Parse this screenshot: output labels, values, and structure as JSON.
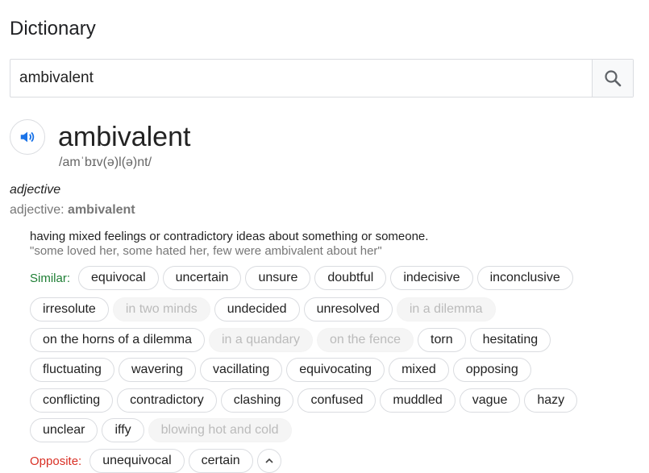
{
  "header": {
    "title": "Dictionary"
  },
  "search": {
    "value": "ambivalent",
    "button_icon": "search-icon"
  },
  "entry": {
    "audio_icon": "speaker-icon",
    "word": "ambivalent",
    "phonetic": "/amˈbɪv(ə)l(ə)nt/",
    "part_of_speech": "adjective",
    "form_label": "adjective: ",
    "form_word": "ambivalent",
    "definition": "having mixed feelings or contradictory ideas about something or someone.",
    "example": "\"some loved her, some hated her, few were ambivalent about her\""
  },
  "similar": {
    "label": "Similar:",
    "row1": [
      {
        "text": "equivocal",
        "faded": false
      },
      {
        "text": "uncertain",
        "faded": false
      },
      {
        "text": "unsure",
        "faded": false
      },
      {
        "text": "doubtful",
        "faded": false
      },
      {
        "text": "indecisive",
        "faded": false
      },
      {
        "text": "inconclusive",
        "faded": false
      }
    ],
    "row2": [
      {
        "text": "irresolute",
        "faded": false
      },
      {
        "text": "in two minds",
        "faded": true
      },
      {
        "text": "undecided",
        "faded": false
      },
      {
        "text": "unresolved",
        "faded": false
      },
      {
        "text": "in a dilemma",
        "faded": true
      }
    ],
    "row3": [
      {
        "text": "on the horns of a dilemma",
        "faded": false
      },
      {
        "text": "in a quandary",
        "faded": true
      },
      {
        "text": "on the fence",
        "faded": true
      },
      {
        "text": "torn",
        "faded": false
      },
      {
        "text": "hesitating",
        "faded": false
      }
    ],
    "row4": [
      {
        "text": "fluctuating",
        "faded": false
      },
      {
        "text": "wavering",
        "faded": false
      },
      {
        "text": "vacillating",
        "faded": false
      },
      {
        "text": "equivocating",
        "faded": false
      },
      {
        "text": "mixed",
        "faded": false
      },
      {
        "text": "opposing",
        "faded": false
      }
    ],
    "row5": [
      {
        "text": "conflicting",
        "faded": false
      },
      {
        "text": "contradictory",
        "faded": false
      },
      {
        "text": "clashing",
        "faded": false
      },
      {
        "text": "confused",
        "faded": false
      },
      {
        "text": "muddled",
        "faded": false
      },
      {
        "text": "vague",
        "faded": false
      },
      {
        "text": "hazy",
        "faded": false
      }
    ],
    "row6": [
      {
        "text": "unclear",
        "faded": false
      },
      {
        "text": "iffy",
        "faded": false
      },
      {
        "text": "blowing hot and cold",
        "faded": true
      }
    ]
  },
  "opposite": {
    "label": "Opposite:",
    "items": [
      {
        "text": "unequivocal",
        "faded": false
      },
      {
        "text": "certain",
        "faded": false
      }
    ],
    "collapse_icon": "chevron-up-icon"
  },
  "colors": {
    "accent_blue": "#1a73e8",
    "similar_green": "#1e7e34",
    "opposite_red": "#d93025"
  }
}
